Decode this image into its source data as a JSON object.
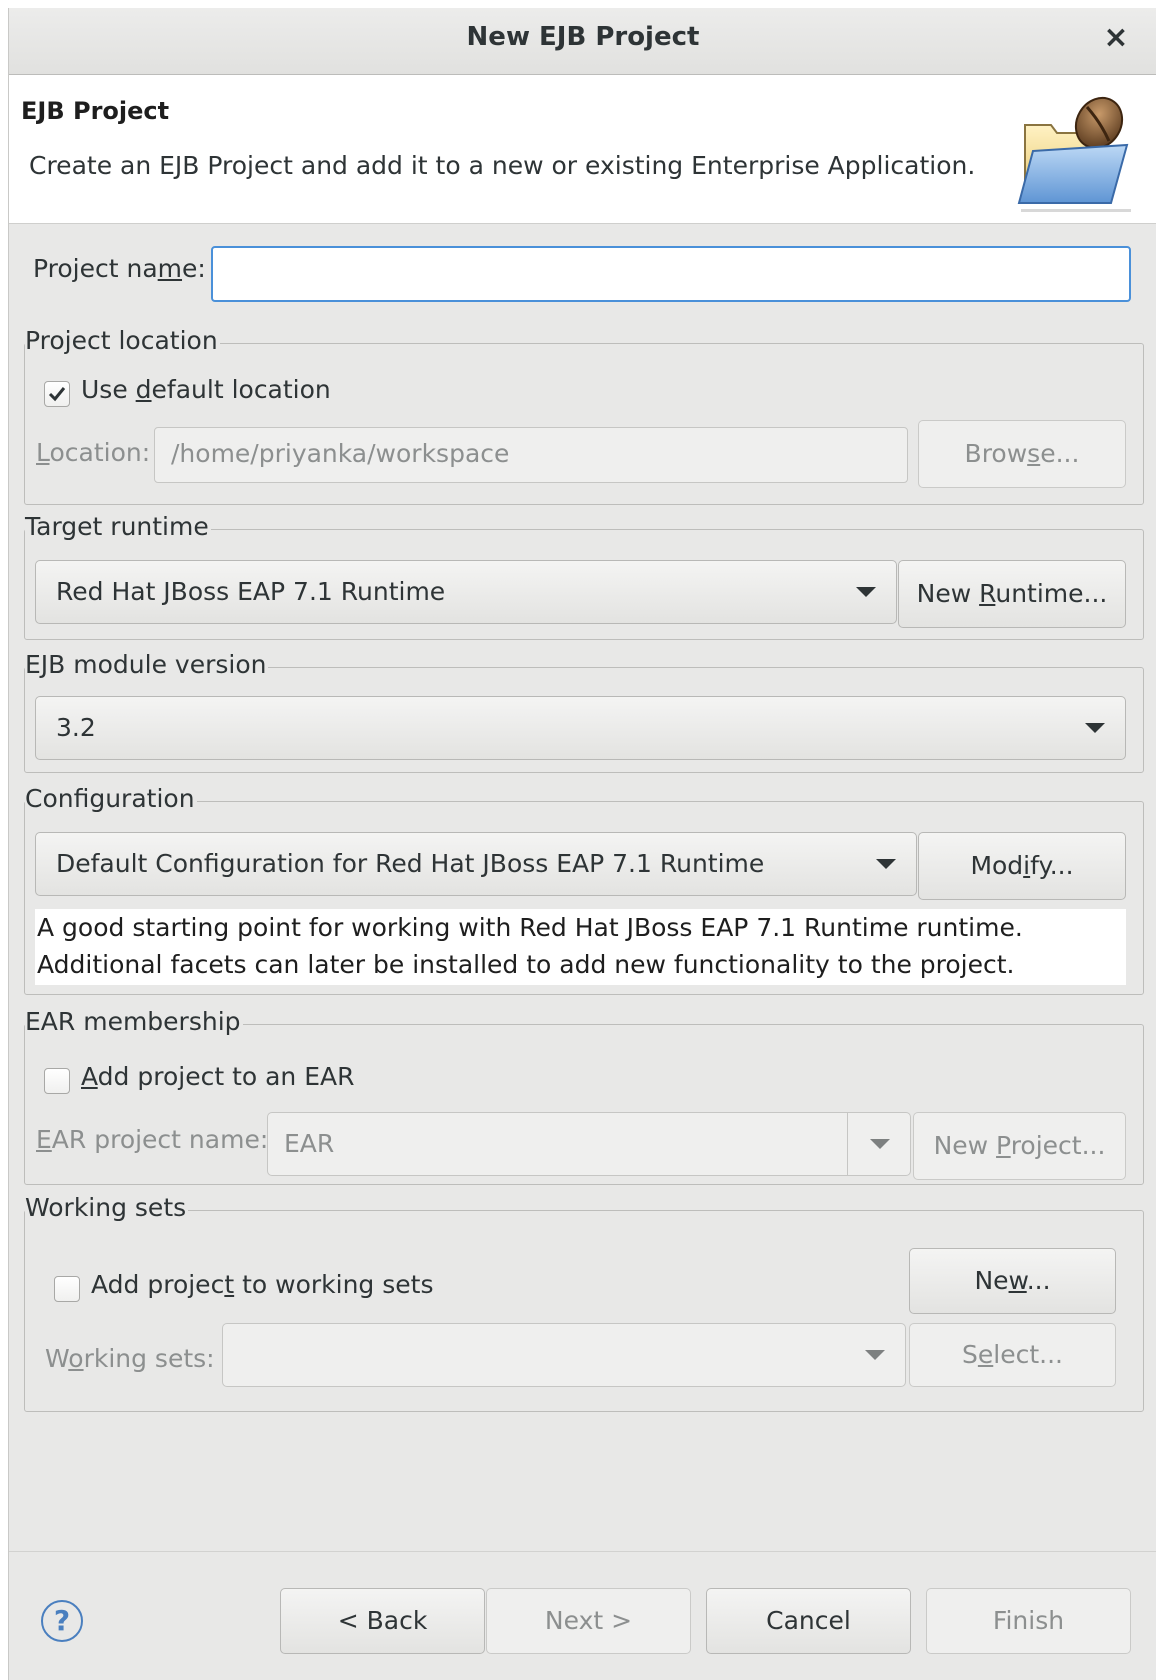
{
  "window": {
    "title": "New EJB Project",
    "close_glyph": "×"
  },
  "header": {
    "title": "EJB Project",
    "description": "Create an EJB Project and add it to a new or existing Enterprise Application.",
    "icon": "folder-ejb-icon"
  },
  "project_name": {
    "label_pre": "Project na",
    "label_mn": "m",
    "label_post": "e:",
    "value": ""
  },
  "project_location": {
    "group_label": "Project location",
    "use_default": {
      "label_pre": "Use ",
      "label_mn": "d",
      "label_post": "efault location",
      "checked": true
    },
    "location_label_mn": "L",
    "location_label_post": "ocation:",
    "location_value": "/home/priyanka/workspace",
    "browse_pre": "Brow",
    "browse_mn": "s",
    "browse_post": "e..."
  },
  "target_runtime": {
    "group_label": "Target runtime",
    "selected": "Red Hat JBoss EAP 7.1 Runtime",
    "new_runtime_pre": "New ",
    "new_runtime_mn": "R",
    "new_runtime_post": "untime..."
  },
  "ejb_module_version": {
    "group_label": "EJB module version",
    "selected": "3.2"
  },
  "configuration": {
    "group_label": "Configuration",
    "selected": "Default Configuration for Red Hat JBoss EAP 7.1 Runtime",
    "modify_pre": "Mod",
    "modify_mn": "i",
    "modify_post": "fy...",
    "desc_line1": "A good starting point for working with Red Hat JBoss EAP 7.1 Runtime runtime.",
    "desc_line2": "Additional facets can later be installed to add new functionality to the project."
  },
  "ear_membership": {
    "group_label": "EAR membership",
    "add_to_ear": {
      "label_mn": "A",
      "label_post": "dd project to an EAR",
      "checked": false
    },
    "ear_name_label_mn": "E",
    "ear_name_label_post": "AR project name:",
    "ear_name_value": "EAR",
    "new_project_pre": "New ",
    "new_project_mn": "P",
    "new_project_post": "roject..."
  },
  "working_sets": {
    "group_label": "Working sets",
    "add_to_ws": {
      "label_pre": "Add projec",
      "label_mn": "t",
      "label_post": " to working sets",
      "checked": false
    },
    "new_pre": "Ne",
    "new_mn": "w",
    "new_post": "...",
    "ws_label_pre": "W",
    "ws_label_mn": "o",
    "ws_label_post": "rking sets:",
    "ws_value": "",
    "select_pre": "S",
    "select_mn": "e",
    "select_post": "lect..."
  },
  "footer": {
    "help_glyph": "?",
    "back": "< Back",
    "next": "Next >",
    "cancel": "Cancel",
    "finish": "Finish"
  }
}
